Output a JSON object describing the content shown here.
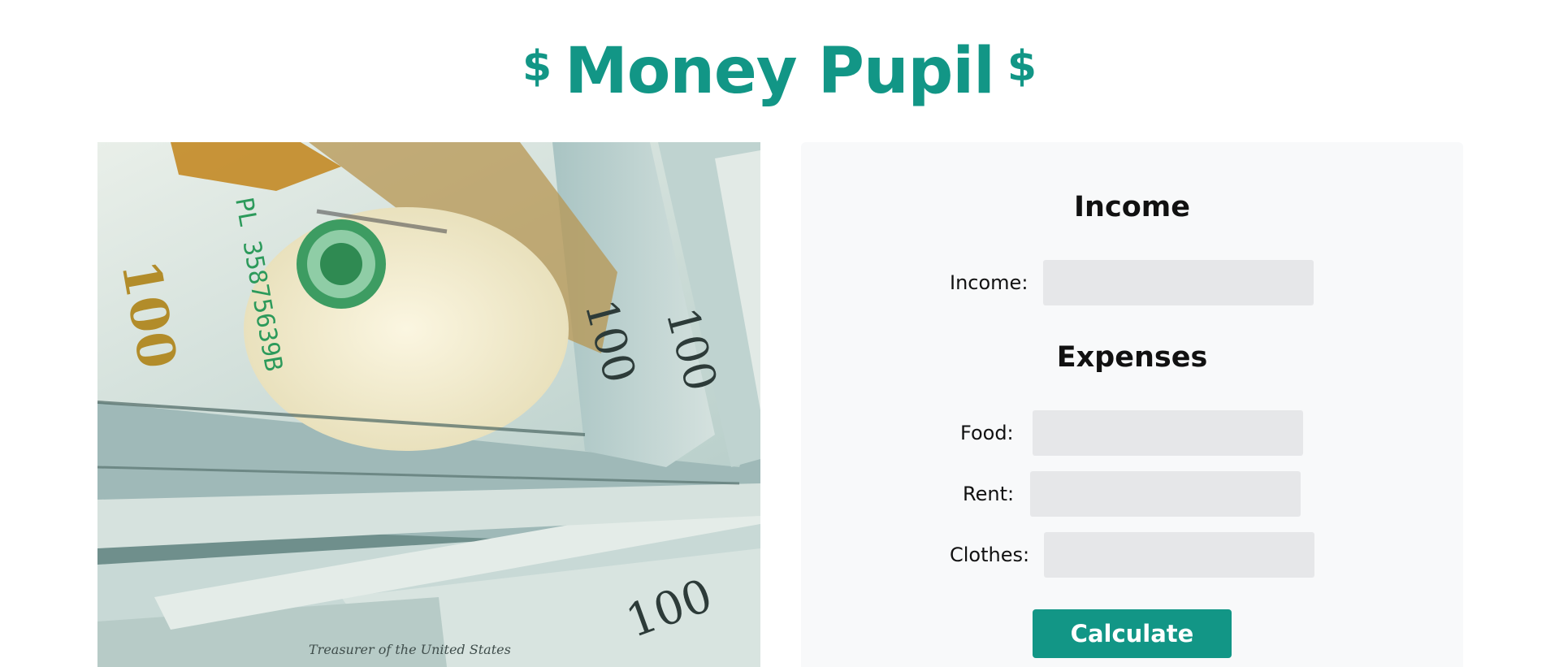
{
  "header": {
    "title": "Money Pupil",
    "left_symbol": "$",
    "right_symbol": "$"
  },
  "image": {
    "subject": "stack of 100 dollar bills",
    "bill_denomination": "100",
    "serial_fragment": "PL 35875639B"
  },
  "form": {
    "income_heading": "Income",
    "income_label": "Income:",
    "income_value": "",
    "expenses_heading": "Expenses",
    "food_label": "Food:",
    "food_value": "",
    "rent_label": "Rent:",
    "rent_value": "",
    "clothes_label": "Clothes:",
    "clothes_value": "",
    "calculate_label": "Calculate"
  },
  "colors": {
    "brand": "#129686",
    "panel_bg": "#f8f9fa",
    "input_bg": "#e6e7e9"
  }
}
